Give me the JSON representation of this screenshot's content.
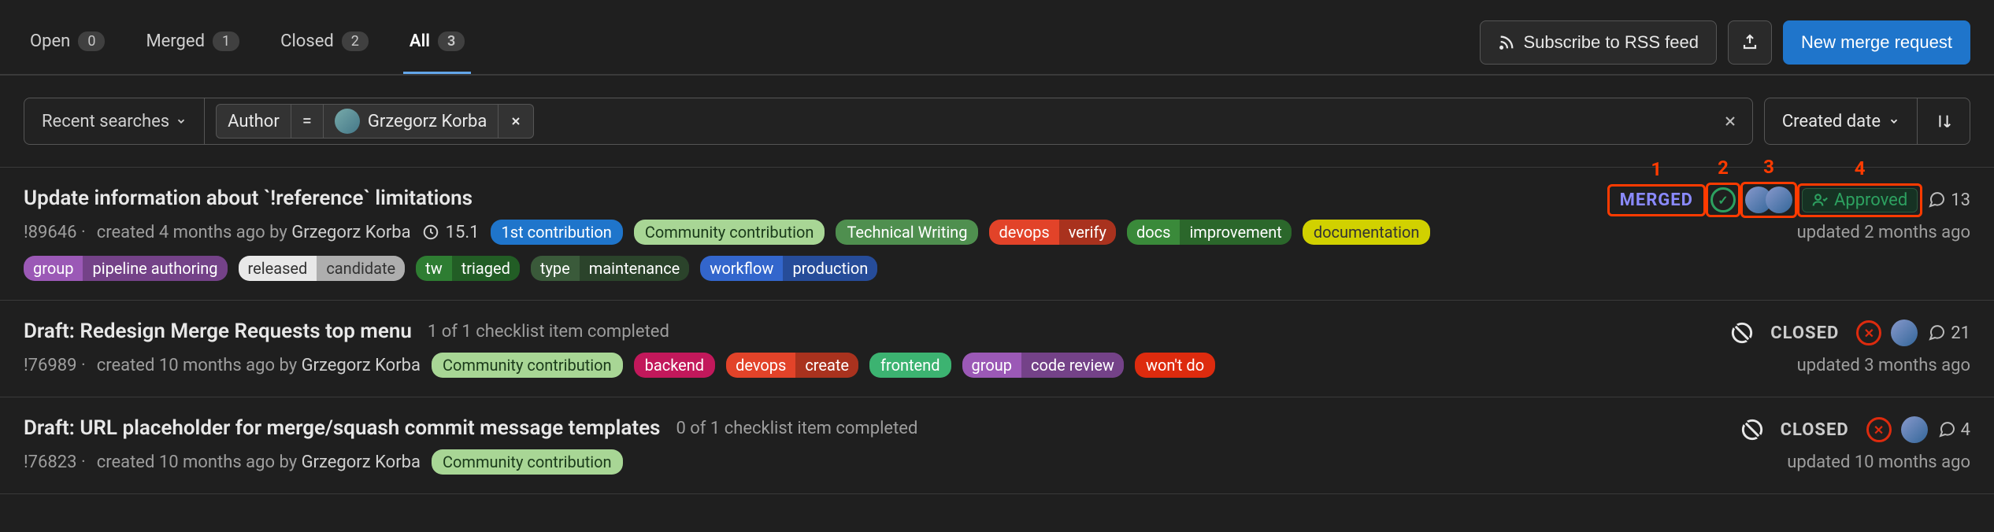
{
  "tabs": {
    "open": {
      "label": "Open",
      "count": "0"
    },
    "merged": {
      "label": "Merged",
      "count": "1"
    },
    "closed": {
      "label": "Closed",
      "count": "2"
    },
    "all": {
      "label": "All",
      "count": "3"
    }
  },
  "header": {
    "subscribe": "Subscribe to RSS feed",
    "newMr": "New merge request"
  },
  "filter": {
    "recent": "Recent searches",
    "authorKey": "Author",
    "op": "=",
    "authorVal": "Grzegorz Korba"
  },
  "sort": {
    "field": "Created date"
  },
  "items": [
    {
      "title": "Update information about `!reference` limitations",
      "ref": "!89646",
      "created": "created 4 months ago by",
      "author": "Grzegorz Korba",
      "milestone": "15.1",
      "checklist": "",
      "labels": [
        {
          "scope": "1st contribution",
          "value": "",
          "bg": "#1f75cb",
          "fg": "#ffffff"
        },
        {
          "scope": "Community contribution",
          "value": "",
          "bg": "#a8d695",
          "fg": "#1a3a1a"
        },
        {
          "scope": "Technical Writing",
          "value": "",
          "bg": "#4f8f4f",
          "fg": "#ffffff"
        },
        {
          "scope": "devops",
          "value": "verify",
          "bg": "#e24329",
          "fg": "#ffffff"
        },
        {
          "scope": "docs",
          "value": "improvement",
          "bg": "#3a8a3a",
          "fg": "#ffffff"
        },
        {
          "scope": "documentation",
          "value": "",
          "bg": "#d1d100",
          "fg": "#333333"
        },
        {
          "scope": "group",
          "value": "pipeline authoring",
          "bg": "#9b59b6",
          "fg": "#ffffff"
        },
        {
          "scope": "released",
          "value": "candidate",
          "bg": "#e8e8e8",
          "fg": "#333333"
        },
        {
          "scope": "tw",
          "value": "triaged",
          "bg": "#2e7d32",
          "fg": "#ffffff"
        },
        {
          "scope": "type",
          "value": "maintenance",
          "bg": "#3a5a3a",
          "fg": "#ffffff"
        },
        {
          "scope": "workflow",
          "value": "production",
          "bg": "#3366cc",
          "fg": "#ffffff"
        }
      ],
      "status": "MERGED",
      "statusColor": "#8a8aff",
      "pipeline": "success",
      "assignees": 2,
      "approved": "Approved",
      "comments": "13",
      "updated": "updated 2 months ago",
      "annot": [
        "1",
        "2",
        "3",
        "4"
      ]
    },
    {
      "title": "Draft: Redesign Merge Requests top menu",
      "ref": "!76989",
      "created": "created 10 months ago by",
      "author": "Grzegorz Korba",
      "milestone": "",
      "checklist": "1 of 1 checklist item completed",
      "labels": [
        {
          "scope": "Community contribution",
          "value": "",
          "bg": "#a8d695",
          "fg": "#1a3a1a"
        },
        {
          "scope": "backend",
          "value": "",
          "bg": "#c2185b",
          "fg": "#ffffff"
        },
        {
          "scope": "devops",
          "value": "create",
          "bg": "#e24329",
          "fg": "#ffffff"
        },
        {
          "scope": "frontend",
          "value": "",
          "bg": "#3cb371",
          "fg": "#ffffff"
        },
        {
          "scope": "group",
          "value": "code review",
          "bg": "#9b59b6",
          "fg": "#ffffff"
        },
        {
          "scope": "won't do",
          "value": "",
          "bg": "#dd2b0e",
          "fg": "#ffffff"
        }
      ],
      "status": "CLOSED",
      "statusColor": "#cccccc",
      "pipeline": "fail",
      "assignees": 1,
      "approved": "",
      "comments": "21",
      "updated": "updated 3 months ago",
      "annot": []
    },
    {
      "title": "Draft: URL placeholder for merge/squash commit message templates",
      "ref": "!76823",
      "created": "created 10 months ago by",
      "author": "Grzegorz Korba",
      "milestone": "",
      "checklist": "0 of 1 checklist item completed",
      "labels": [
        {
          "scope": "Community contribution",
          "value": "",
          "bg": "#a8d695",
          "fg": "#1a3a1a"
        }
      ],
      "status": "CLOSED",
      "statusColor": "#cccccc",
      "pipeline": "fail",
      "assignees": 1,
      "approved": "",
      "comments": "4",
      "updated": "updated 10 months ago",
      "annot": []
    }
  ]
}
